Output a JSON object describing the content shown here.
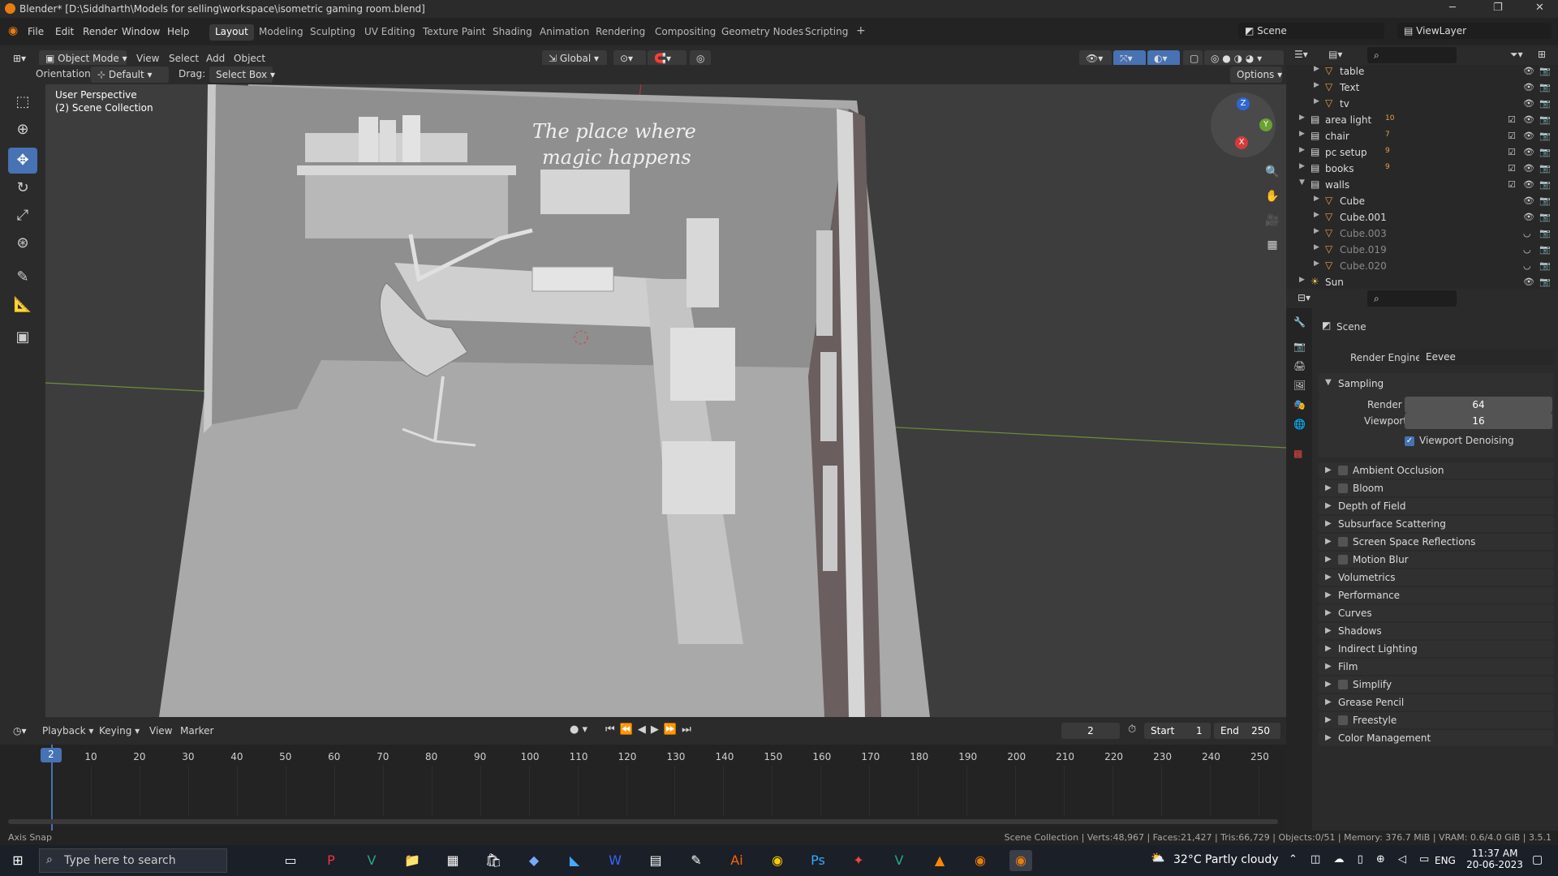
{
  "title": "Blender* [D:\\Siddharth\\Models for selling\\workspace\\isometric gaming room.blend]",
  "menus": [
    "File",
    "Edit",
    "Render",
    "Window",
    "Help"
  ],
  "workspaces": [
    "Layout",
    "Modeling",
    "Sculpting",
    "UV Editing",
    "Texture Paint",
    "Shading",
    "Animation",
    "Rendering",
    "Compositing",
    "Geometry Nodes",
    "Scripting"
  ],
  "scene_field": "Scene",
  "viewlayer_field": "ViewLayer",
  "viewport_header": {
    "mode": "Object Mode",
    "menus": [
      "View",
      "Select",
      "Add",
      "Object"
    ],
    "transform": "Global",
    "orientation_label": "Orientation:",
    "orientation_value": "Default",
    "drag_label": "Drag:",
    "drag_value": "Select Box",
    "options": "Options"
  },
  "viewport_overlay": {
    "line1": "User Perspective",
    "line2": "(2) Scene Collection",
    "wall_text_1": "The place where",
    "wall_text_2": "magic happens"
  },
  "gizmo": {
    "z": "Z",
    "y": "Y",
    "x": "X"
  },
  "outliner": [
    {
      "name": "table",
      "indent": 2,
      "dim": false,
      "icon": "mesh-icon"
    },
    {
      "name": "Text",
      "indent": 2,
      "dim": false,
      "icon": "mesh-icon"
    },
    {
      "name": "tv",
      "indent": 2,
      "dim": false,
      "icon": "mesh-icon"
    },
    {
      "name": "area light",
      "indent": 1,
      "dim": false,
      "icon": "collection-icon",
      "badge": "10"
    },
    {
      "name": "chair",
      "indent": 1,
      "dim": false,
      "icon": "collection-icon",
      "badge": "7"
    },
    {
      "name": "pc setup",
      "indent": 1,
      "dim": false,
      "icon": "collection-icon",
      "badge": "9"
    },
    {
      "name": "books",
      "indent": 1,
      "dim": false,
      "icon": "collection-icon",
      "badge": "9"
    },
    {
      "name": "walls",
      "indent": 1,
      "dim": false,
      "icon": "collection-icon",
      "expanded": true
    },
    {
      "name": "Cube",
      "indent": 2,
      "dim": false,
      "icon": "mesh-icon"
    },
    {
      "name": "Cube.001",
      "indent": 2,
      "dim": false,
      "icon": "mesh-icon"
    },
    {
      "name": "Cube.003",
      "indent": 2,
      "dim": true,
      "icon": "mesh-icon"
    },
    {
      "name": "Cube.019",
      "indent": 2,
      "dim": true,
      "icon": "mesh-icon"
    },
    {
      "name": "Cube.020",
      "indent": 2,
      "dim": true,
      "icon": "mesh-icon"
    },
    {
      "name": "Sun",
      "indent": 1,
      "dim": false,
      "icon": "light-icon"
    }
  ],
  "properties": {
    "context": "Scene",
    "render_engine_label": "Render Engine",
    "render_engine": "Eevee",
    "sampling": "Sampling",
    "render_label": "Render",
    "render_value": "64",
    "viewport_label": "Viewport",
    "viewport_value": "16",
    "denoising": "Viewport Denoising",
    "panels": [
      {
        "name": "Ambient Occlusion",
        "checkbox": true
      },
      {
        "name": "Bloom",
        "checkbox": true
      },
      {
        "name": "Depth of Field",
        "checkbox": false
      },
      {
        "name": "Subsurface Scattering",
        "checkbox": false
      },
      {
        "name": "Screen Space Reflections",
        "checkbox": true
      },
      {
        "name": "Motion Blur",
        "checkbox": true
      },
      {
        "name": "Volumetrics",
        "checkbox": false
      },
      {
        "name": "Performance",
        "checkbox": false
      },
      {
        "name": "Curves",
        "checkbox": false
      },
      {
        "name": "Shadows",
        "checkbox": false
      },
      {
        "name": "Indirect Lighting",
        "checkbox": false
      },
      {
        "name": "Film",
        "checkbox": false
      },
      {
        "name": "Simplify",
        "checkbox": true
      },
      {
        "name": "Grease Pencil",
        "checkbox": false
      },
      {
        "name": "Freestyle",
        "checkbox": true
      },
      {
        "name": "Color Management",
        "checkbox": false
      }
    ]
  },
  "timeline": {
    "menus": [
      "Playback",
      "Keying",
      "View",
      "Marker"
    ],
    "current_frame": "2",
    "start_label": "Start",
    "start": "1",
    "end_label": "End",
    "end": "250",
    "ticks": [
      "2",
      "10",
      "20",
      "30",
      "40",
      "50",
      "60",
      "70",
      "80",
      "90",
      "100",
      "110",
      "120",
      "130",
      "140",
      "150",
      "160",
      "170",
      "180",
      "190",
      "200",
      "210",
      "220",
      "230",
      "240",
      "250"
    ]
  },
  "statusbar": {
    "left": "Axis Snap",
    "right": "Scene Collection | Verts:48,967 | Faces:21,427 | Tris:66,729 | Objects:0/51 | Memory: 376.7 MiB | VRAM: 0.6/4.0 GiB | 3.5.1"
  },
  "taskbar": {
    "search_placeholder": "Type here to search",
    "weather": "32°C  Partly cloudy",
    "lang": "ENG",
    "time": "11:37 AM",
    "date": "20-06-2023"
  }
}
